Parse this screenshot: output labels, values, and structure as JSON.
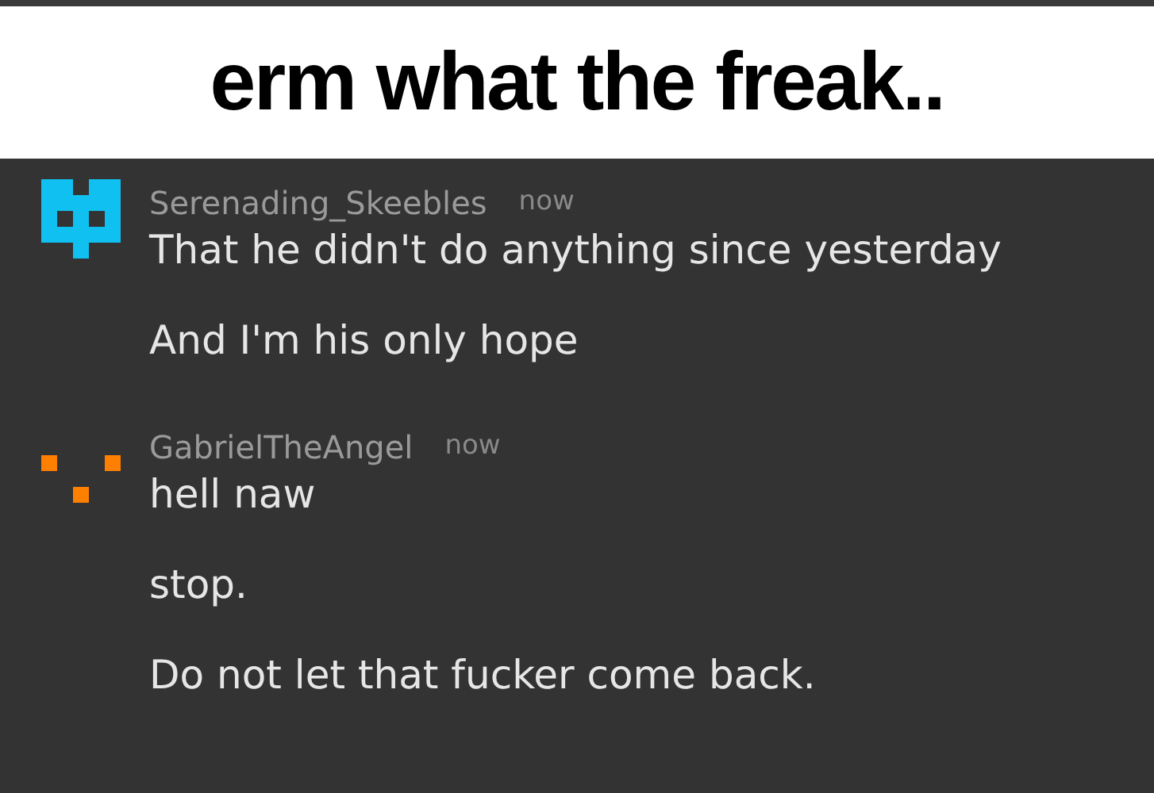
{
  "caption": "erm what the freak..",
  "messages": [
    {
      "username": "Serenading_Skeebles",
      "time": "now",
      "color": "#0fc0f0",
      "lines": [
        "That he didn't do anything since yesterday",
        "And I'm his only hope"
      ]
    },
    {
      "username": "GabrielTheAngel",
      "time": "now",
      "color": "#ff7f00",
      "lines": [
        "hell naw",
        "stop.",
        "Do not let that fucker come back."
      ]
    }
  ]
}
